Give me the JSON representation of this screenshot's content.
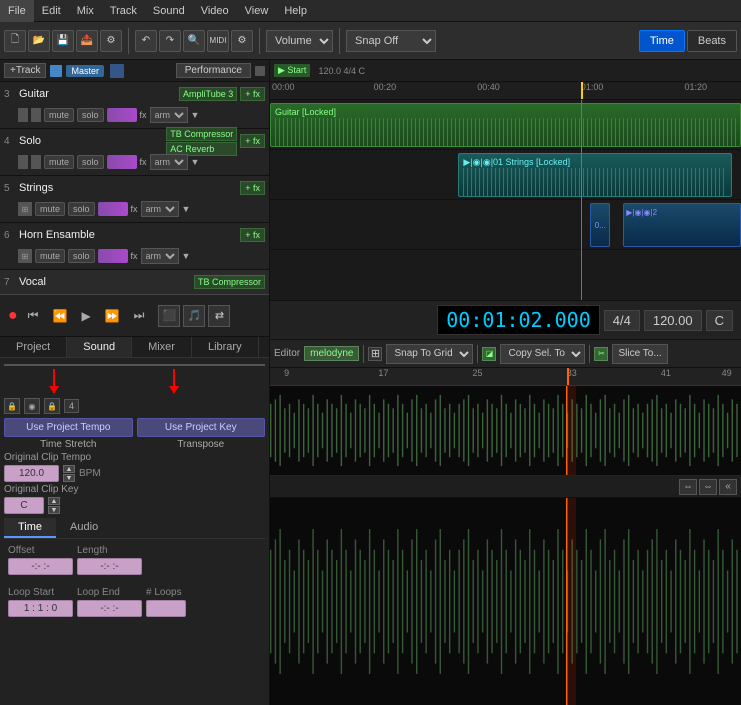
{
  "menubar": {
    "items": [
      "File",
      "Edit",
      "Mix",
      "Track",
      "Sound",
      "Video",
      "View",
      "Help"
    ]
  },
  "toolbar": {
    "volume_label": "Volume",
    "snap_label": "Snap Off",
    "time_btn": "Time",
    "beats_btn": "Beats"
  },
  "track_header": {
    "add_track": "+Track",
    "master": "Master",
    "performance": "Performance"
  },
  "tracks": [
    {
      "num": "3",
      "name": "Guitar",
      "fx": "AmpliTube 3",
      "plus_fx": "+ fx"
    },
    {
      "num": "4",
      "name": "Solo",
      "fx1": "TB Compressor",
      "fx2": "AC Reverb",
      "plus_fx": "+ fx"
    },
    {
      "num": "5",
      "name": "Strings",
      "plus_fx": "+ fx"
    },
    {
      "num": "6",
      "name": "Horn Ensamble",
      "plus_fx": "+ fx"
    },
    {
      "num": "7",
      "name": "Vocal"
    }
  ],
  "transport": {
    "time": "00:01:02.000",
    "time_sig": "4/4",
    "tempo": "120.00",
    "key": "C"
  },
  "bottom_tabs": [
    "Project",
    "Sound",
    "Mixer",
    "Library"
  ],
  "active_bottom_tab": "Sound",
  "sound_section": {
    "title": "Sound",
    "use_project_tempo": "Use Project Tempo",
    "use_project_key": "Use Project Key",
    "time_stretch_label": "Time Stretch",
    "transpose_label": "Transpose",
    "original_clip_tempo_label": "Original Clip Tempo",
    "original_clip_tempo_value": "120.0",
    "original_clip_tempo_unit": "BPM",
    "original_clip_key_label": "Original Clip Key",
    "original_clip_key_value": "C"
  },
  "time_audio_tabs": [
    "Time",
    "Audio"
  ],
  "active_ta_tab": "Time",
  "offset_section": {
    "offset_label": "Offset",
    "offset_value": "-:- :-",
    "length_label": "Length",
    "length_value": "-:- :-",
    "loop_start_label": "Loop Start",
    "loop_start_value": "1 : 1 : 0",
    "loop_end_label": "Loop End",
    "loop_end_value": "-:- :-",
    "loops_label": "# Loops",
    "loops_value": ""
  },
  "editor": {
    "label": "Editor",
    "plugin": "melodyne",
    "snap_to_grid": "Snap To Grid",
    "copy_sel_to": "Copy Sel. To",
    "slice_to": "Slice To..."
  },
  "timeline": {
    "start_label": "Start",
    "position": "120.0 4/4 C",
    "time_markers": [
      "00:00",
      "00:20",
      "00:40",
      "01:00",
      "01:20"
    ],
    "ruler_marks": [
      "9",
      "17",
      "25",
      "33",
      "41",
      "49"
    ]
  }
}
